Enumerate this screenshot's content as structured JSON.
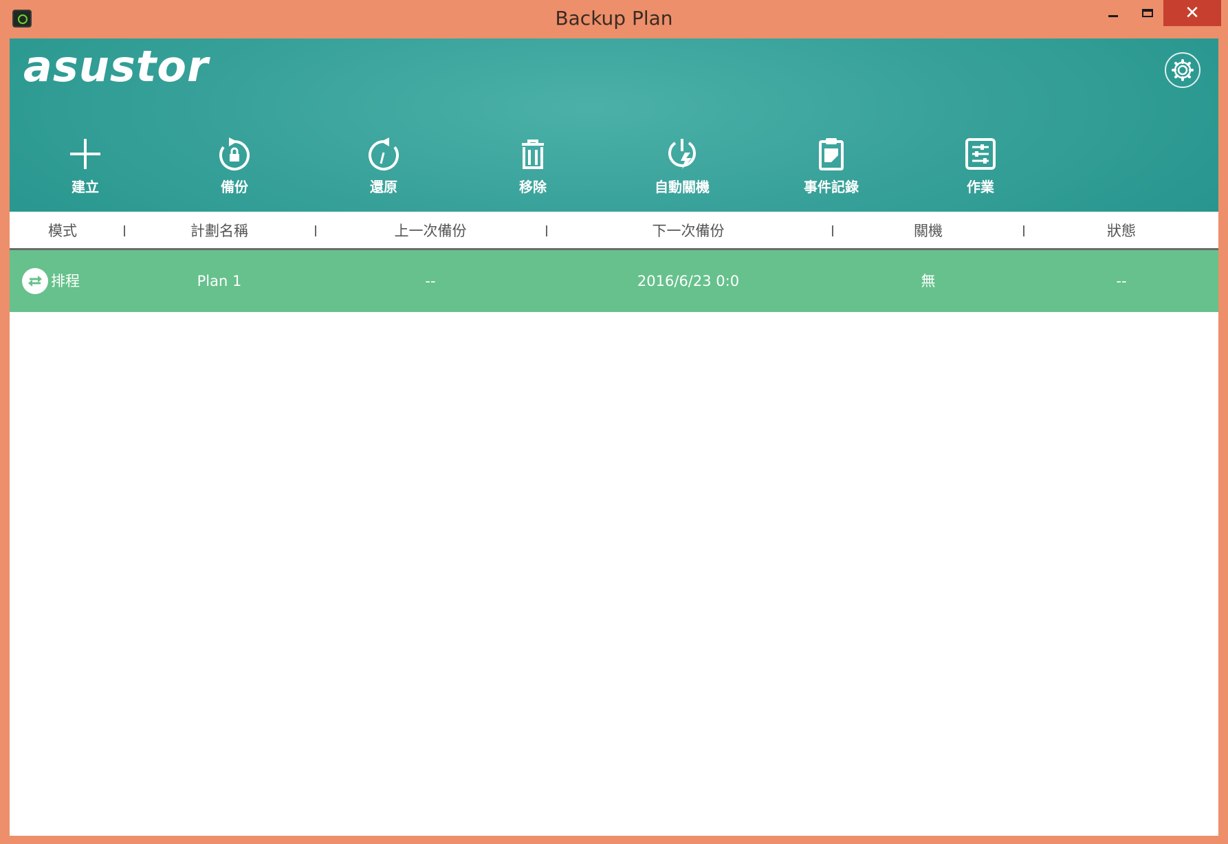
{
  "window": {
    "title": "Backup Plan",
    "close_glyph": "✕"
  },
  "header": {
    "logo": "asustor",
    "settings_icon": "gear-icon"
  },
  "toolbar": {
    "items": [
      {
        "label": "建立",
        "icon": "plus-icon"
      },
      {
        "label": "備份",
        "icon": "backup-lock-icon"
      },
      {
        "label": "還原",
        "icon": "restore-icon"
      },
      {
        "label": "移除",
        "icon": "trash-icon"
      },
      {
        "label": "自動關機",
        "icon": "power-bolt-icon"
      },
      {
        "label": "事件記錄",
        "icon": "clipboard-icon"
      },
      {
        "label": "作業",
        "icon": "task-list-icon"
      }
    ]
  },
  "table": {
    "columns": [
      "模式",
      "計劃名稱",
      "上一次備份",
      "下一次備份",
      "關機",
      "狀態"
    ],
    "rows": [
      {
        "mode": "排程",
        "name": "Plan 1",
        "last_backup": "--",
        "next_backup": "2016/6/23 0:0",
        "shutdown": "無",
        "status": "--"
      }
    ]
  },
  "colors": {
    "window_frame": "#ec8f6a",
    "header_teal": "#3aa39b",
    "row_selected": "#66c18c",
    "close_button": "#c7402f"
  }
}
